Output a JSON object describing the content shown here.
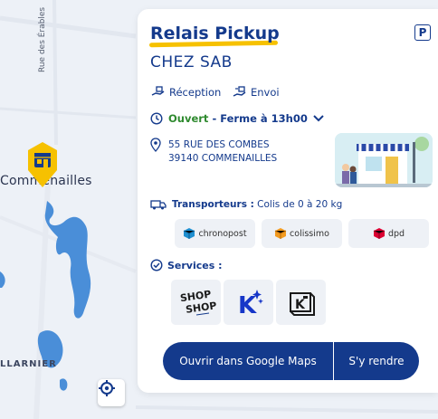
{
  "map": {
    "town_name": "Commenailles",
    "street_name": "Rue des Érables",
    "village_name": "LLARNIER"
  },
  "card": {
    "title": "Relais Pickup",
    "name": "CHEZ SAB",
    "reception_label": "Réception",
    "envoi_label": "Envoi",
    "status": "Ouvert",
    "hours": "- Ferme à 13h00",
    "address_line1": "55 RUE DES COMBES",
    "address_line2": "39140 COMMENAILLES",
    "transporteurs_label": "Transporteurs :",
    "transporteurs_detail": "Colis de 0 à 20 kg",
    "carriers": [
      {
        "name": "chronopost",
        "color": "#1f8fd0"
      },
      {
        "name": "colissimo",
        "color": "#f29a1f"
      },
      {
        "name": "dpd",
        "color": "#dc0032"
      }
    ],
    "services_label": "Services :",
    "services": [
      "shop-shop",
      "kelbillet",
      "locker"
    ],
    "services_logo_text": {
      "shop": "SHOP",
      "shop2": "SHOP",
      "k": "K"
    },
    "parking_symbol": "P",
    "btn_maps": "Ouvrir dans Google Maps",
    "btn_go": "S'y rendre"
  },
  "colors": {
    "primary": "#143a8c",
    "accent": "#f6c100",
    "open": "#2f8a2f",
    "water": "#4a8ed8"
  }
}
